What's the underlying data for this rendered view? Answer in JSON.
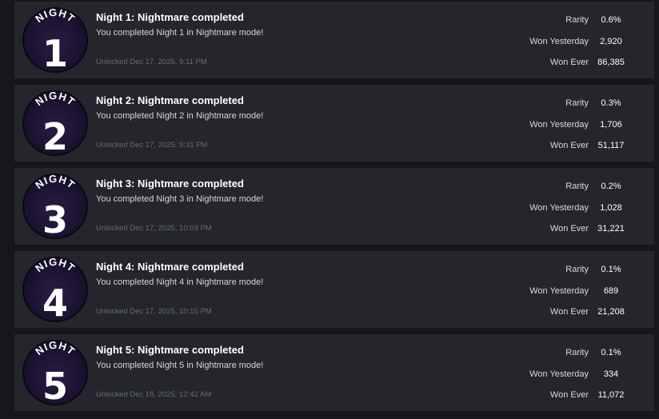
{
  "achievements": [
    {
      "badge_word": "NIGHT",
      "badge_number": "1",
      "title": "Night 1: Nightmare completed",
      "description": "You completed Night 1 in Nightmare mode!",
      "unlocked": "Unlocked Dec 17, 2025, 9:11 PM",
      "stats": [
        {
          "label": "Rarity",
          "value": "0.6%"
        },
        {
          "label": "Won Yesterday",
          "value": "2,920"
        },
        {
          "label": "Won Ever",
          "value": "86,385"
        }
      ]
    },
    {
      "badge_word": "NIGHT",
      "badge_number": "2",
      "title": "Night 2: Nightmare completed",
      "description": "You completed Night 2 in Nightmare mode!",
      "unlocked": "Unlocked Dec 17, 2025, 9:31 PM",
      "stats": [
        {
          "label": "Rarity",
          "value": "0.3%"
        },
        {
          "label": "Won Yesterday",
          "value": "1,706"
        },
        {
          "label": "Won Ever",
          "value": "51,117"
        }
      ]
    },
    {
      "badge_word": "NIGHT",
      "badge_number": "3",
      "title": "Night 3: Nightmare completed",
      "description": "You completed Night 3 in Nightmare mode!",
      "unlocked": "Unlocked Dec 17, 2025, 10:03 PM",
      "stats": [
        {
          "label": "Rarity",
          "value": "0.2%"
        },
        {
          "label": "Won Yesterday",
          "value": "1,028"
        },
        {
          "label": "Won Ever",
          "value": "31,221"
        }
      ]
    },
    {
      "badge_word": "NIGHT",
      "badge_number": "4",
      "title": "Night 4: Nightmare completed",
      "description": "You completed Night 4 in Nightmare mode!",
      "unlocked": "Unlocked Dec 17, 2025, 10:15 PM",
      "stats": [
        {
          "label": "Rarity",
          "value": "0.1%"
        },
        {
          "label": "Won Yesterday",
          "value": "689"
        },
        {
          "label": "Won Ever",
          "value": "21,208"
        }
      ]
    },
    {
      "badge_word": "NIGHT",
      "badge_number": "5",
      "title": "Night 5: Nightmare completed",
      "description": "You completed Night 5 in Nightmare mode!",
      "unlocked": "Unlocked Dec 18, 2025, 12:42 AM",
      "stats": [
        {
          "label": "Rarity",
          "value": "0.1%"
        },
        {
          "label": "Won Yesterday",
          "value": "334"
        },
        {
          "label": "Won Ever",
          "value": "11,072"
        }
      ]
    }
  ],
  "colors": {
    "page_bg": "#16171b",
    "card_bg": "#24262c",
    "badge_purple": "#2a1c44",
    "unlocked_text": "#676a72"
  }
}
